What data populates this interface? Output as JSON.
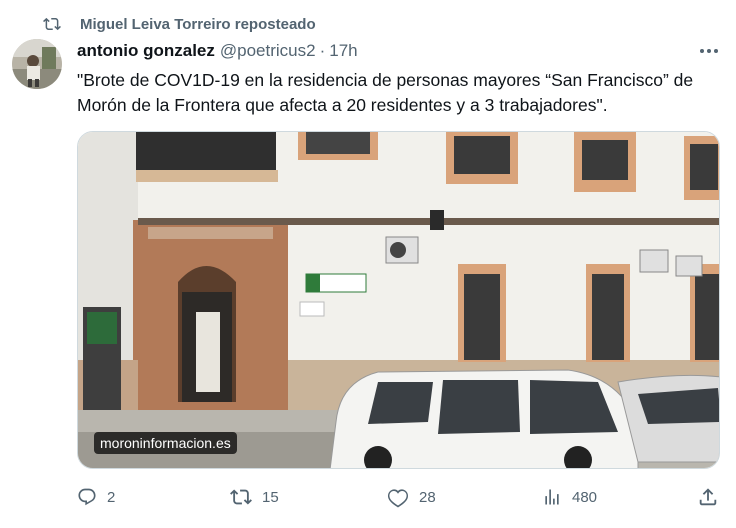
{
  "repost": {
    "label": "Miguel Leiva Torreiro reposteado",
    "icon": "repost-icon"
  },
  "author": {
    "name": "antonio gonzalez",
    "handle": "@poetricus2",
    "separator": "·",
    "time": "17h"
  },
  "tweet": {
    "text": "\"Brote de COV1D-19 en la residencia de personas mayores “San Francisco” de Morón de la Frontera que afecta a 20 residentes y a 3 trabajadores\"."
  },
  "media": {
    "watermark": "moroninformacion.es"
  },
  "actions": {
    "replies": "2",
    "reposts": "15",
    "likes": "28",
    "views": "480"
  },
  "colors": {
    "text": "#0f1419",
    "secondary": "#536471",
    "border": "#cfd9de"
  }
}
